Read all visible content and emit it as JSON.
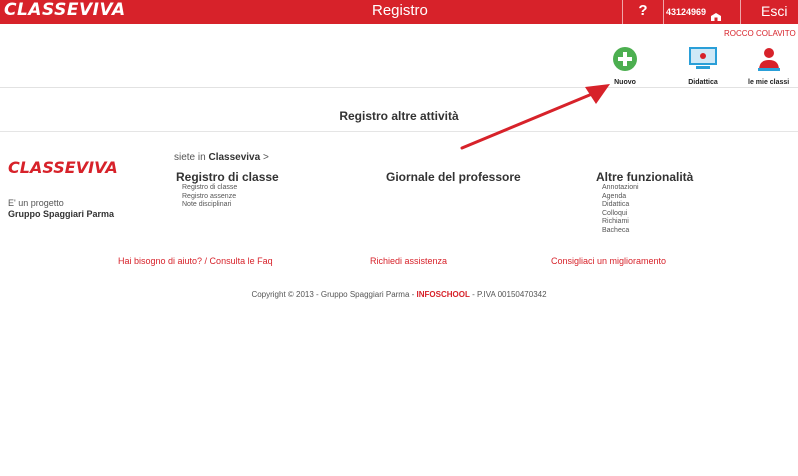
{
  "app": {
    "brand": "CLASSEVIVA",
    "title": "Registro",
    "help_label": "?",
    "user_code": "43124969",
    "exit_label": "Esci",
    "username": "ROCCO COLAVITO"
  },
  "toolbar": {
    "items": [
      {
        "label": "Nuovo",
        "icon": "plus-circle-icon"
      },
      {
        "label": "Didattica",
        "icon": "board-icon"
      },
      {
        "label": "le mie classi",
        "icon": "teacher-icon"
      }
    ]
  },
  "page": {
    "title": "Registro altre attività"
  },
  "footer": {
    "logo": "CLASSEVIVA",
    "project_label": "E' un progetto",
    "project_org": "Gruppo Spaggiari Parma",
    "here_prefix": "siete in",
    "here_name": "Classeviva",
    "here_suffix": ">",
    "columns": [
      {
        "title": "Registro di classe",
        "items": [
          "Registro di classe",
          "Registro assenze",
          "Note disciplinari"
        ]
      },
      {
        "title": "Giornale del professore",
        "items": []
      },
      {
        "title": "Altre funzionalità",
        "items": [
          "Annotazioni",
          "Agenda",
          "Didattica",
          "Colloqui",
          "Richiami",
          "Bacheca"
        ]
      }
    ],
    "links": {
      "help": "Hai bisogno di aiuto? / Consulta le Faq",
      "assist": "Richiedi assistenza",
      "improve": "Consigliaci un miglioramento"
    },
    "copyright_prefix": "Copyright © 2013 - Gruppo Spaggiari Parma - ",
    "copyright_brand": "INFOSCHOOL",
    "copyright_suffix": " - P.IVA 00150470342"
  },
  "colors": {
    "brand_red": "#d7222a",
    "plus_green": "#4caf50"
  }
}
